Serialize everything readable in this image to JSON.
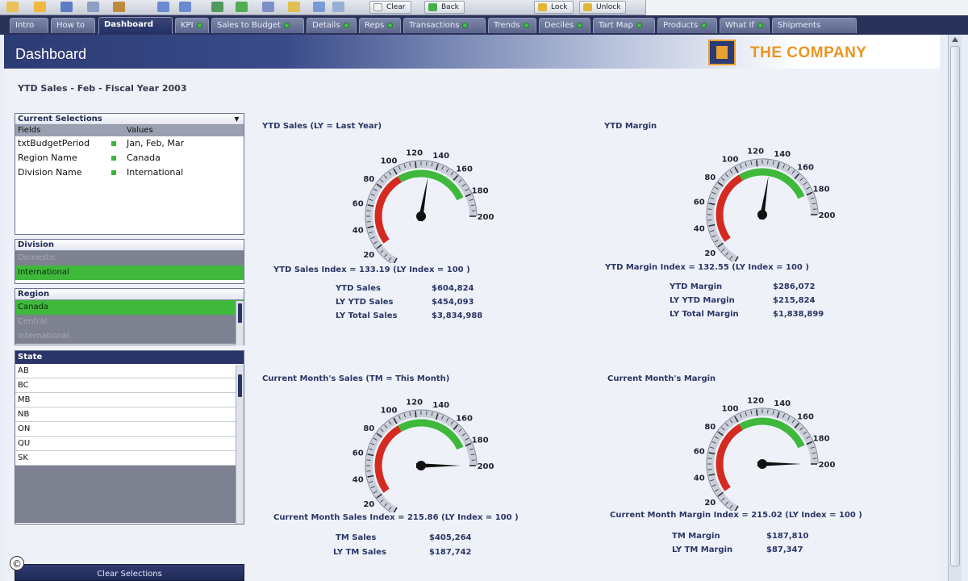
{
  "toolbar": {
    "buttons": [
      "Clear",
      "Back",
      "Lock",
      "Unlock"
    ]
  },
  "tabs": [
    {
      "label": "Intro"
    },
    {
      "label": "How to"
    },
    {
      "label": "Dashboard",
      "active": true
    },
    {
      "label": "KPI"
    },
    {
      "label": "Sales to Budget"
    },
    {
      "label": "Details"
    },
    {
      "label": "Reps"
    },
    {
      "label": "Transactions"
    },
    {
      "label": "Trends"
    },
    {
      "label": "Deciles"
    },
    {
      "label": "Tart Map"
    },
    {
      "label": "Products"
    },
    {
      "label": "What If"
    },
    {
      "label": "Shipments"
    }
  ],
  "header": {
    "title": "Dashboard",
    "company": "THE COMPANY"
  },
  "subtitle": "YTD Sales - Feb - Fiscal Year 2003",
  "current_selections": {
    "caption": "Current Selections",
    "col_fields": "Fields",
    "col_values": "Values",
    "rows": [
      {
        "field": "txtBudgetPeriod",
        "value": "Jan, Feb, Mar"
      },
      {
        "field": "Region Name",
        "value": "Canada"
      },
      {
        "field": "Division Name",
        "value": "International"
      }
    ]
  },
  "division": {
    "caption": "Division",
    "options": [
      {
        "label": "Domestic",
        "state": "excluded"
      },
      {
        "label": "International",
        "state": "selected"
      }
    ]
  },
  "region": {
    "caption": "Region",
    "options": [
      {
        "label": "Canada",
        "state": "selected"
      },
      {
        "label": "Central",
        "state": "excluded"
      },
      {
        "label": "International",
        "state": "excluded"
      }
    ]
  },
  "state": {
    "caption": "State",
    "options": [
      {
        "label": "AB",
        "state": "possible"
      },
      {
        "label": "BC",
        "state": "possible"
      },
      {
        "label": "MB",
        "state": "possible"
      },
      {
        "label": "NB",
        "state": "possible"
      },
      {
        "label": "ON",
        "state": "possible"
      },
      {
        "label": "QU",
        "state": "possible"
      },
      {
        "label": "SK",
        "state": "possible"
      },
      {
        "label": "",
        "state": "excluded"
      },
      {
        "label": "",
        "state": "excluded"
      },
      {
        "label": "",
        "state": "excluded"
      },
      {
        "label": "",
        "state": "excluded"
      }
    ]
  },
  "clear_selections_label": "Clear Selections",
  "copyright_symbol": "©",
  "gauges": [
    {
      "title": "YTD Sales  (LY = Last Year)",
      "value": 133.19,
      "min": 0,
      "max": 200,
      "ticks": [
        0,
        20,
        40,
        60,
        80,
        100,
        120,
        140,
        160,
        180,
        200
      ],
      "red_range": [
        20,
        100
      ],
      "green_range": [
        100,
        180
      ],
      "index_text": "YTD Sales Index = 133.19 (LY Index  = 100 )",
      "stats": [
        {
          "label": "YTD Sales",
          "value": "$604,824"
        },
        {
          "label": "LY YTD Sales",
          "value": "$454,093"
        },
        {
          "label": "LY Total Sales",
          "value": "$3,834,988"
        }
      ]
    },
    {
      "title": "YTD Margin",
      "value": 132.55,
      "min": 0,
      "max": 200,
      "ticks": [
        0,
        20,
        40,
        60,
        80,
        100,
        120,
        140,
        160,
        180,
        200
      ],
      "red_range": [
        20,
        100
      ],
      "green_range": [
        100,
        180
      ],
      "index_text": "YTD Margin Index = 132.55 (LY Index  = 100 )",
      "stats": [
        {
          "label": "YTD Margin",
          "value": "$286,072"
        },
        {
          "label": "LY YTD Margin",
          "value": "$215,824"
        },
        {
          "label": "LY Total Margin",
          "value": "$1,838,899"
        }
      ]
    },
    {
      "title": "Current Month's Sales  (TM = This Month)",
      "value": 215.86,
      "min": 0,
      "max": 200,
      "ticks": [
        0,
        20,
        40,
        60,
        80,
        100,
        120,
        140,
        160,
        180,
        200
      ],
      "red_range": [
        20,
        100
      ],
      "green_range": [
        100,
        180
      ],
      "index_text": "Current Month Sales Index = 215.86 (LY Index  = 100 )",
      "stats": [
        {
          "label": "TM Sales",
          "value": "$405,264"
        },
        {
          "label": "LY TM Sales",
          "value": "$187,742"
        }
      ]
    },
    {
      "title": "Current Month's Margin",
      "value": 215.02,
      "min": 0,
      "max": 200,
      "ticks": [
        0,
        20,
        40,
        60,
        80,
        100,
        120,
        140,
        160,
        180,
        200
      ],
      "red_range": [
        20,
        100
      ],
      "green_range": [
        100,
        180
      ],
      "index_text": "Current Month Margin Index = 215.02 (LY Index  = 100 )",
      "stats": [
        {
          "label": "TM Margin",
          "value": "$187,810"
        },
        {
          "label": "LY TM Margin",
          "value": "$87,347"
        }
      ]
    }
  ],
  "colors": {
    "gauge_red": "#d42a22",
    "gauge_green": "#3fb83c",
    "navy": "#2b3566",
    "selected_green": "#3fb83c",
    "brand_orange": "#e89520"
  }
}
